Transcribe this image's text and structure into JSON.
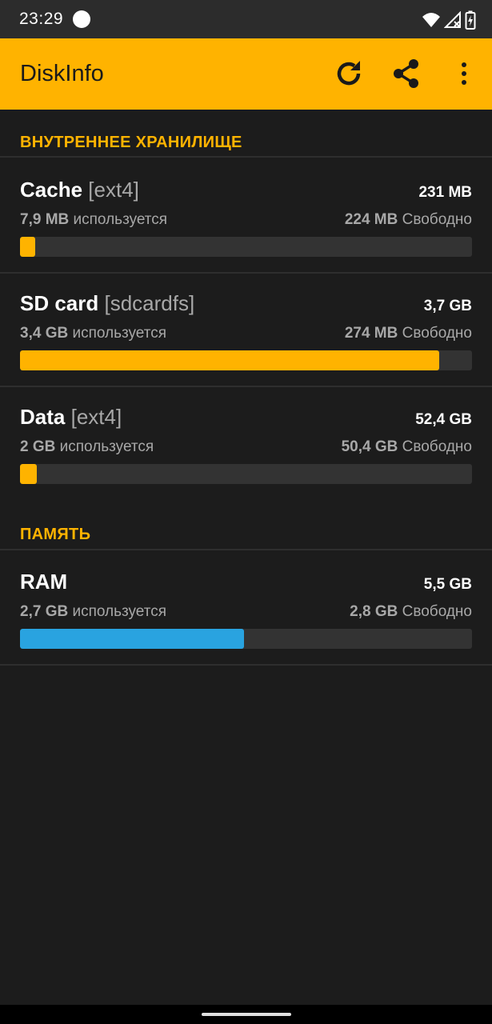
{
  "status_bar": {
    "time": "23:29"
  },
  "app_bar": {
    "title": "DiskInfo",
    "actions": [
      "refresh-icon",
      "share-icon",
      "more-vert-icon"
    ]
  },
  "colors": {
    "accent": "#ffb300",
    "ram": "#29a3e0",
    "track": "#333333",
    "background": "#1c1c1c"
  },
  "sections": [
    {
      "header": "ВНУТРЕННЕЕ ХРАНИЛИЩЕ",
      "items": [
        {
          "name": "Cache",
          "fs": "[ext4]",
          "total": "231 MB",
          "used": "7,9 MB",
          "used_suffix": "используется",
          "free": "224 MB",
          "free_suffix": "Свободно",
          "used_fraction": 0.034,
          "color": "#ffb300"
        },
        {
          "name": "SD card",
          "fs": "[sdcardfs]",
          "total": "3,7 GB",
          "used": "3,4 GB",
          "used_suffix": "используется",
          "free": "274 MB",
          "free_suffix": "Свободно",
          "used_fraction": 0.927,
          "color": "#ffb300"
        },
        {
          "name": "Data",
          "fs": "[ext4]",
          "total": "52,4 GB",
          "used": "2 GB",
          "used_suffix": "используется",
          "free": "50,4 GB",
          "free_suffix": "Свободно",
          "used_fraction": 0.038,
          "color": "#ffb300"
        }
      ]
    },
    {
      "header": "ПАМЯТЬ",
      "items": [
        {
          "name": "RAM",
          "fs": "",
          "total": "5,5 GB",
          "used": "2,7 GB",
          "used_suffix": "используется",
          "free": "2,8 GB",
          "free_suffix": "Свободно",
          "used_fraction": 0.495,
          "color": "#29a3e0"
        }
      ]
    }
  ]
}
